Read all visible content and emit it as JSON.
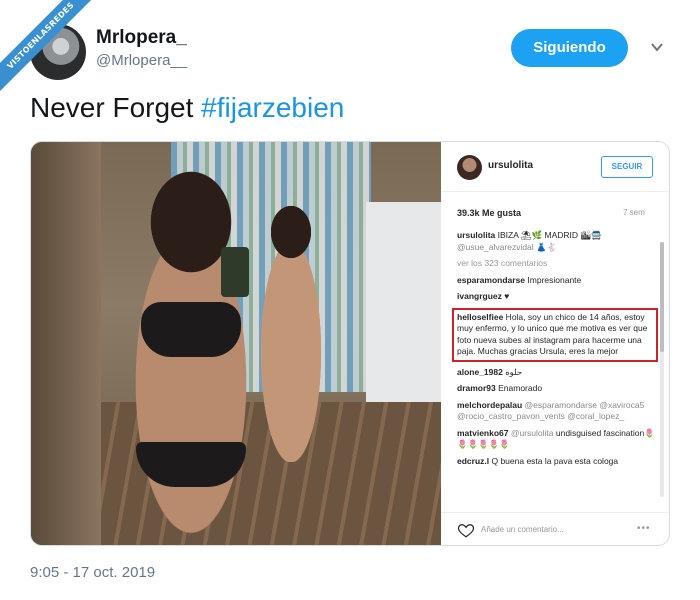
{
  "watermark": "VISTOENLASREDES",
  "tweet": {
    "display_name": "Mrlopera_",
    "handle": "@Mrlopera__",
    "follow_label": "Siguiendo",
    "text_plain": "Never Forget ",
    "hashtag": "#fijarzebien",
    "timestamp": "9:05 - 17 oct. 2019"
  },
  "instagram": {
    "username": "ursulolita",
    "follow_label": "SEGUIR",
    "likes": "39.3k Me gusta",
    "age": "7 sem",
    "comments": [
      {
        "user": "ursulolita",
        "text": " IBIZA ⛱🌿 MADRID 🏙🚍",
        "mention": "@usue_alvarezvidal 👗🐇"
      },
      {
        "text": "ver los 323 comentarios"
      },
      {
        "user": "esparamondarse",
        "text": " Impresionante"
      },
      {
        "user": "ivangrguez",
        "text": " ♥"
      },
      {
        "user": "helloselfiee",
        "text": " Hola, soy un chico de 14 años, estoy muy enfermo, y lo unico que me motiva es ver que foto nueva subes al instagram para hacerme una paja. Muchas gracias Ursula, eres la mejor"
      },
      {
        "user": "alone_1982",
        "text": " حلوه"
      },
      {
        "user": "dramor93",
        "text": " Enamorado"
      },
      {
        "user": "melchordepalau",
        "mention": " @esparamondarse @xaviroca5 @rocio_castro_pavon_vents @coral_lopez_"
      },
      {
        "user": "matvienko67",
        "mention": " @ursulolita",
        "text": " undisguised fascination🌷🌷🌷🌷🌷🌷"
      },
      {
        "user": "edcruz.l",
        "text": " Q buena esta la pava esta cologa"
      }
    ],
    "add_comment_placeholder": "Añade un comentario...",
    "more": "•••"
  }
}
